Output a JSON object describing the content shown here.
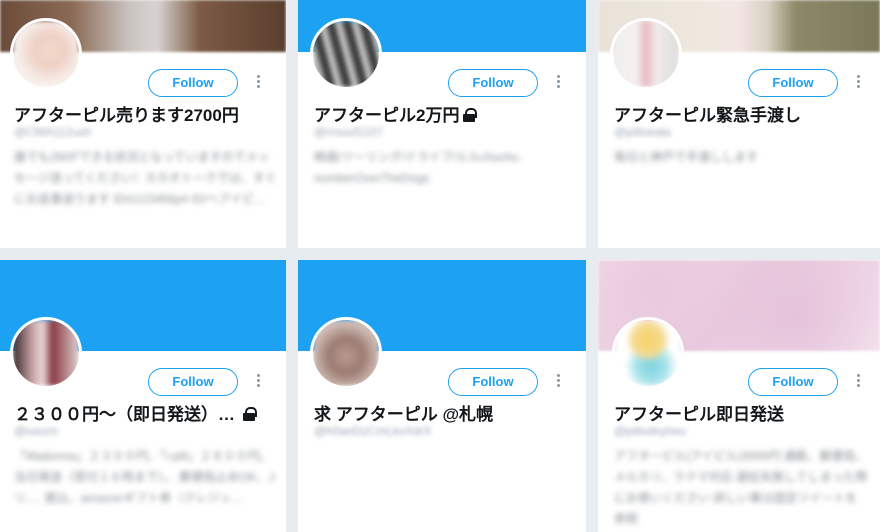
{
  "cards": [
    {
      "name": "アフターピル売ります2700円",
      "handle": "@CMA112uxh",
      "bio": "誰でも2Mができる状況となっていますのでメッセージ送ってください！カカオトークでは、すぐにお返事送ります ID/s123456p4 ID/ヘアイピ…",
      "follow": "Follow",
      "locked": false
    },
    {
      "name": "アフターピル2万円",
      "handle": "@rrouuf1107",
      "bio": "映画/ツーリング/ドライブ/ルルchuchu numberOverTheDogs",
      "follow": "Follow",
      "locked": true
    },
    {
      "name": "アフターピル緊急手渡し",
      "handle": "@pilloeata",
      "bio": "毎日と神戸で手渡しします",
      "follow": "Follow",
      "locked": false
    },
    {
      "name": "２３００円〜（即日発送）…",
      "handle": "@iuezm",
      "bio": "「Madonna」２３００円、「i-pill」２８００円。 当日発送（受付１６時まで）。 郵便局止めOK、Jリ,… 振込、amazonギフト券（クレジッ…",
      "follow": "Follow",
      "locked": true
    },
    {
      "name": "求 アフターピル @札幌",
      "handle": "@h0aeDzCmLkxXdrX",
      "bio": "",
      "follow": "Follow",
      "locked": false
    },
    {
      "name": "アフターピル即日発送",
      "handle": "@pillsdeyheu",
      "bio": "アフターピル(アイピル)3000円 通販、郵便局、メルカリ、ラクマ対応 避妊失敗してしまった際にお使いください 詳しい事は固定ツイートを参照",
      "follow": "Follow",
      "locked": false
    }
  ],
  "colors": {
    "accent": "#1da1f2",
    "background": "#e6ecf0",
    "text": "#14171a"
  }
}
